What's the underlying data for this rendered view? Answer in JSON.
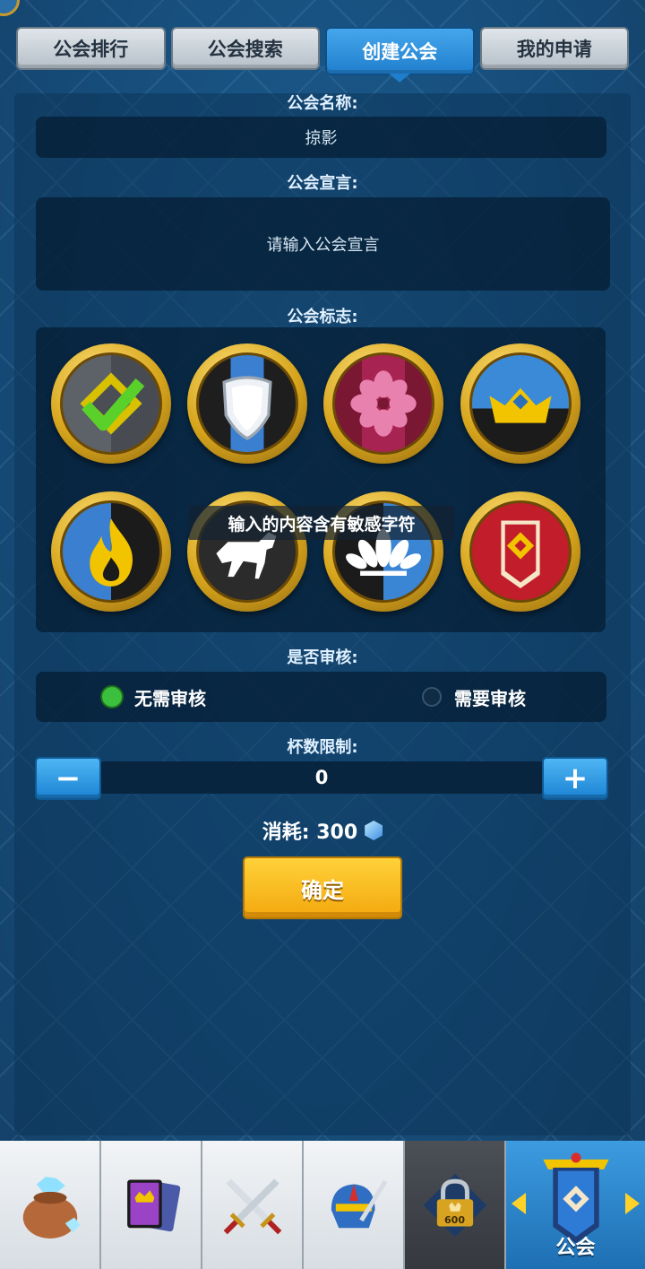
{
  "tabs": [
    {
      "label": "公会排行",
      "active": false
    },
    {
      "label": "公会搜索",
      "active": false
    },
    {
      "label": "创建公会",
      "active": true
    },
    {
      "label": "我的申请",
      "active": false
    }
  ],
  "form": {
    "name_label": "公会名称:",
    "name_value": "掠影",
    "declaration_label": "公会宣言:",
    "declaration_placeholder": "请输入公会宣言",
    "emblem_label": "公会标志:",
    "review_label": "是否审核:",
    "review_options": [
      {
        "label": "无需审核",
        "selected": true
      },
      {
        "label": "需要审核",
        "selected": false
      }
    ],
    "trophy_label": "杯数限制:",
    "trophy_value": "0",
    "minus": "−",
    "plus": "+",
    "cost_label": "消耗: 300",
    "confirm_label": "确定"
  },
  "toast": "输入的内容含有敏感字符",
  "emblems": [
    {
      "icon": "checkmark-emblem-icon",
      "colors": [
        "#5a5f66",
        "#f2c400"
      ]
    },
    {
      "icon": "shield-emblem-icon",
      "colors": [
        "#1e1e1e",
        "#3b7fd1"
      ]
    },
    {
      "icon": "flower-emblem-icon",
      "colors": [
        "#7a1733",
        "#e0679b"
      ]
    },
    {
      "icon": "crown-emblem-icon",
      "colors": [
        "#3a8ad8",
        "#f2c400"
      ]
    },
    {
      "icon": "flame-emblem-icon",
      "colors": [
        "#3a7fd0",
        "#f2c400"
      ]
    },
    {
      "icon": "horse-emblem-icon",
      "colors": [
        "#2a2a2a",
        "#ffffff"
      ]
    },
    {
      "icon": "lotus-emblem-icon",
      "colors": [
        "#1b1b1b",
        "#3a86d4"
      ]
    },
    {
      "icon": "banner-emblem-icon",
      "colors": [
        "#c21d2b",
        "#f2c400"
      ]
    }
  ],
  "bottom_nav": [
    {
      "icon": "gem-bag-icon"
    },
    {
      "icon": "cards-icon"
    },
    {
      "icon": "crossed-swords-icon"
    },
    {
      "icon": "helmet-icon"
    },
    {
      "icon": "lock-icon",
      "badge": "600"
    },
    {
      "icon": "guild-banner-icon",
      "label": "公会"
    }
  ]
}
